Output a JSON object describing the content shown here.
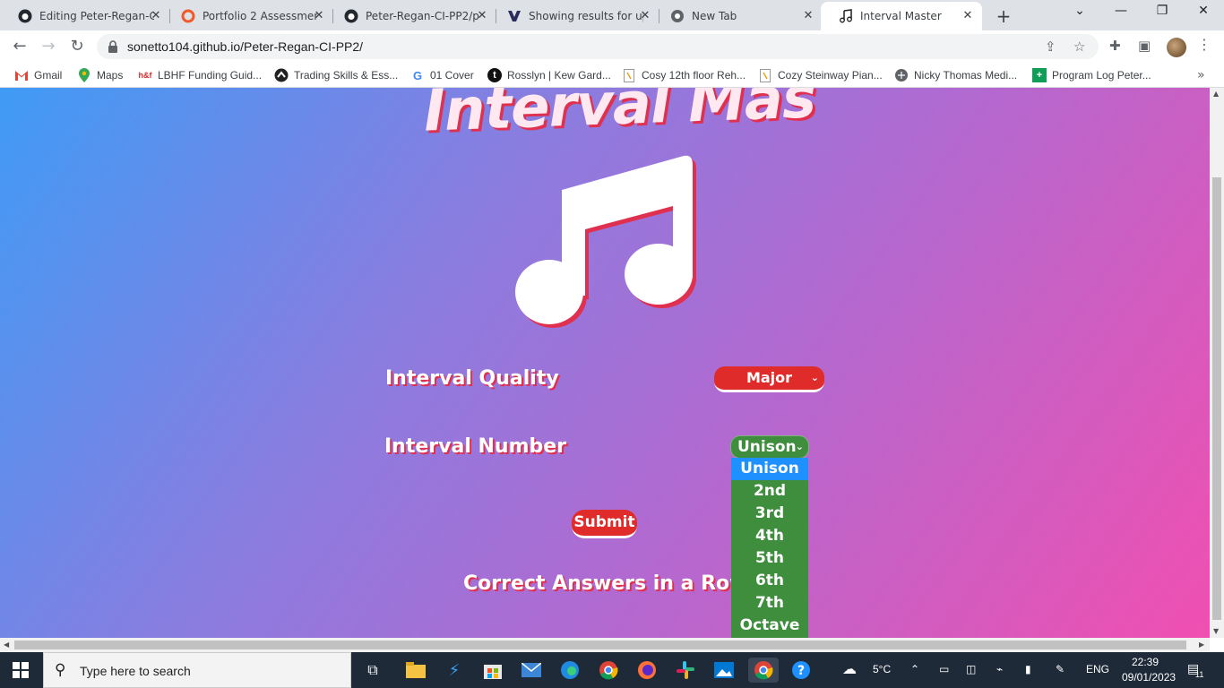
{
  "browser": {
    "tabs": [
      {
        "title": "Editing Peter-Regan-C",
        "icon": "github-icon"
      },
      {
        "title": "Portfolio 2 Assessmen",
        "icon": "portfolio-icon"
      },
      {
        "title": "Peter-Regan-CI-PP2/p",
        "icon": "github-icon"
      },
      {
        "title": "Showing results for up",
        "icon": "search-results-icon"
      },
      {
        "title": "New Tab",
        "icon": "chrome-icon"
      },
      {
        "title": "Interval Master",
        "icon": "music-note-icon"
      }
    ],
    "url": "sonetto104.github.io/Peter-Regan-CI-PP2/"
  },
  "bookmarks": [
    {
      "label": "Gmail",
      "icon": "gmail-icon"
    },
    {
      "label": "Maps",
      "icon": "maps-icon"
    },
    {
      "label": "LBHF Funding Guid...",
      "icon": "hf-icon",
      "mark": "h&f"
    },
    {
      "label": "Trading Skills & Ess...",
      "icon": "trading-icon"
    },
    {
      "label": "01 Cover",
      "icon": "google-icon",
      "mark": "G"
    },
    {
      "label": "Rosslyn | Kew Gard...",
      "icon": "rosslyn-icon",
      "mark": "t"
    },
    {
      "label": "Cosy 12th floor Reh...",
      "icon": "page-icon"
    },
    {
      "label": "Cozy Steinway Pian...",
      "icon": "page-icon"
    },
    {
      "label": "Nicky Thomas Medi...",
      "icon": "web-icon"
    },
    {
      "label": "Program Log Peter...",
      "icon": "sheets-icon",
      "mark": "+"
    }
  ],
  "page": {
    "title": "Interval Mas",
    "quality_label": "Interval Quality",
    "quality_value": "Major",
    "number_label": "Interval Number",
    "number_value": "Unison",
    "number_options": [
      "Unison",
      "2nd",
      "3rd",
      "4th",
      "5th",
      "6th",
      "7th",
      "Octave"
    ],
    "submit_label": "Submit",
    "streak_label": "Correct Answers in a Row:"
  },
  "taskbar": {
    "search_placeholder": "Type here to search",
    "weather": "5°C",
    "language": "ENG",
    "time": "22:39",
    "date": "09/01/2023",
    "notifications": "11"
  }
}
